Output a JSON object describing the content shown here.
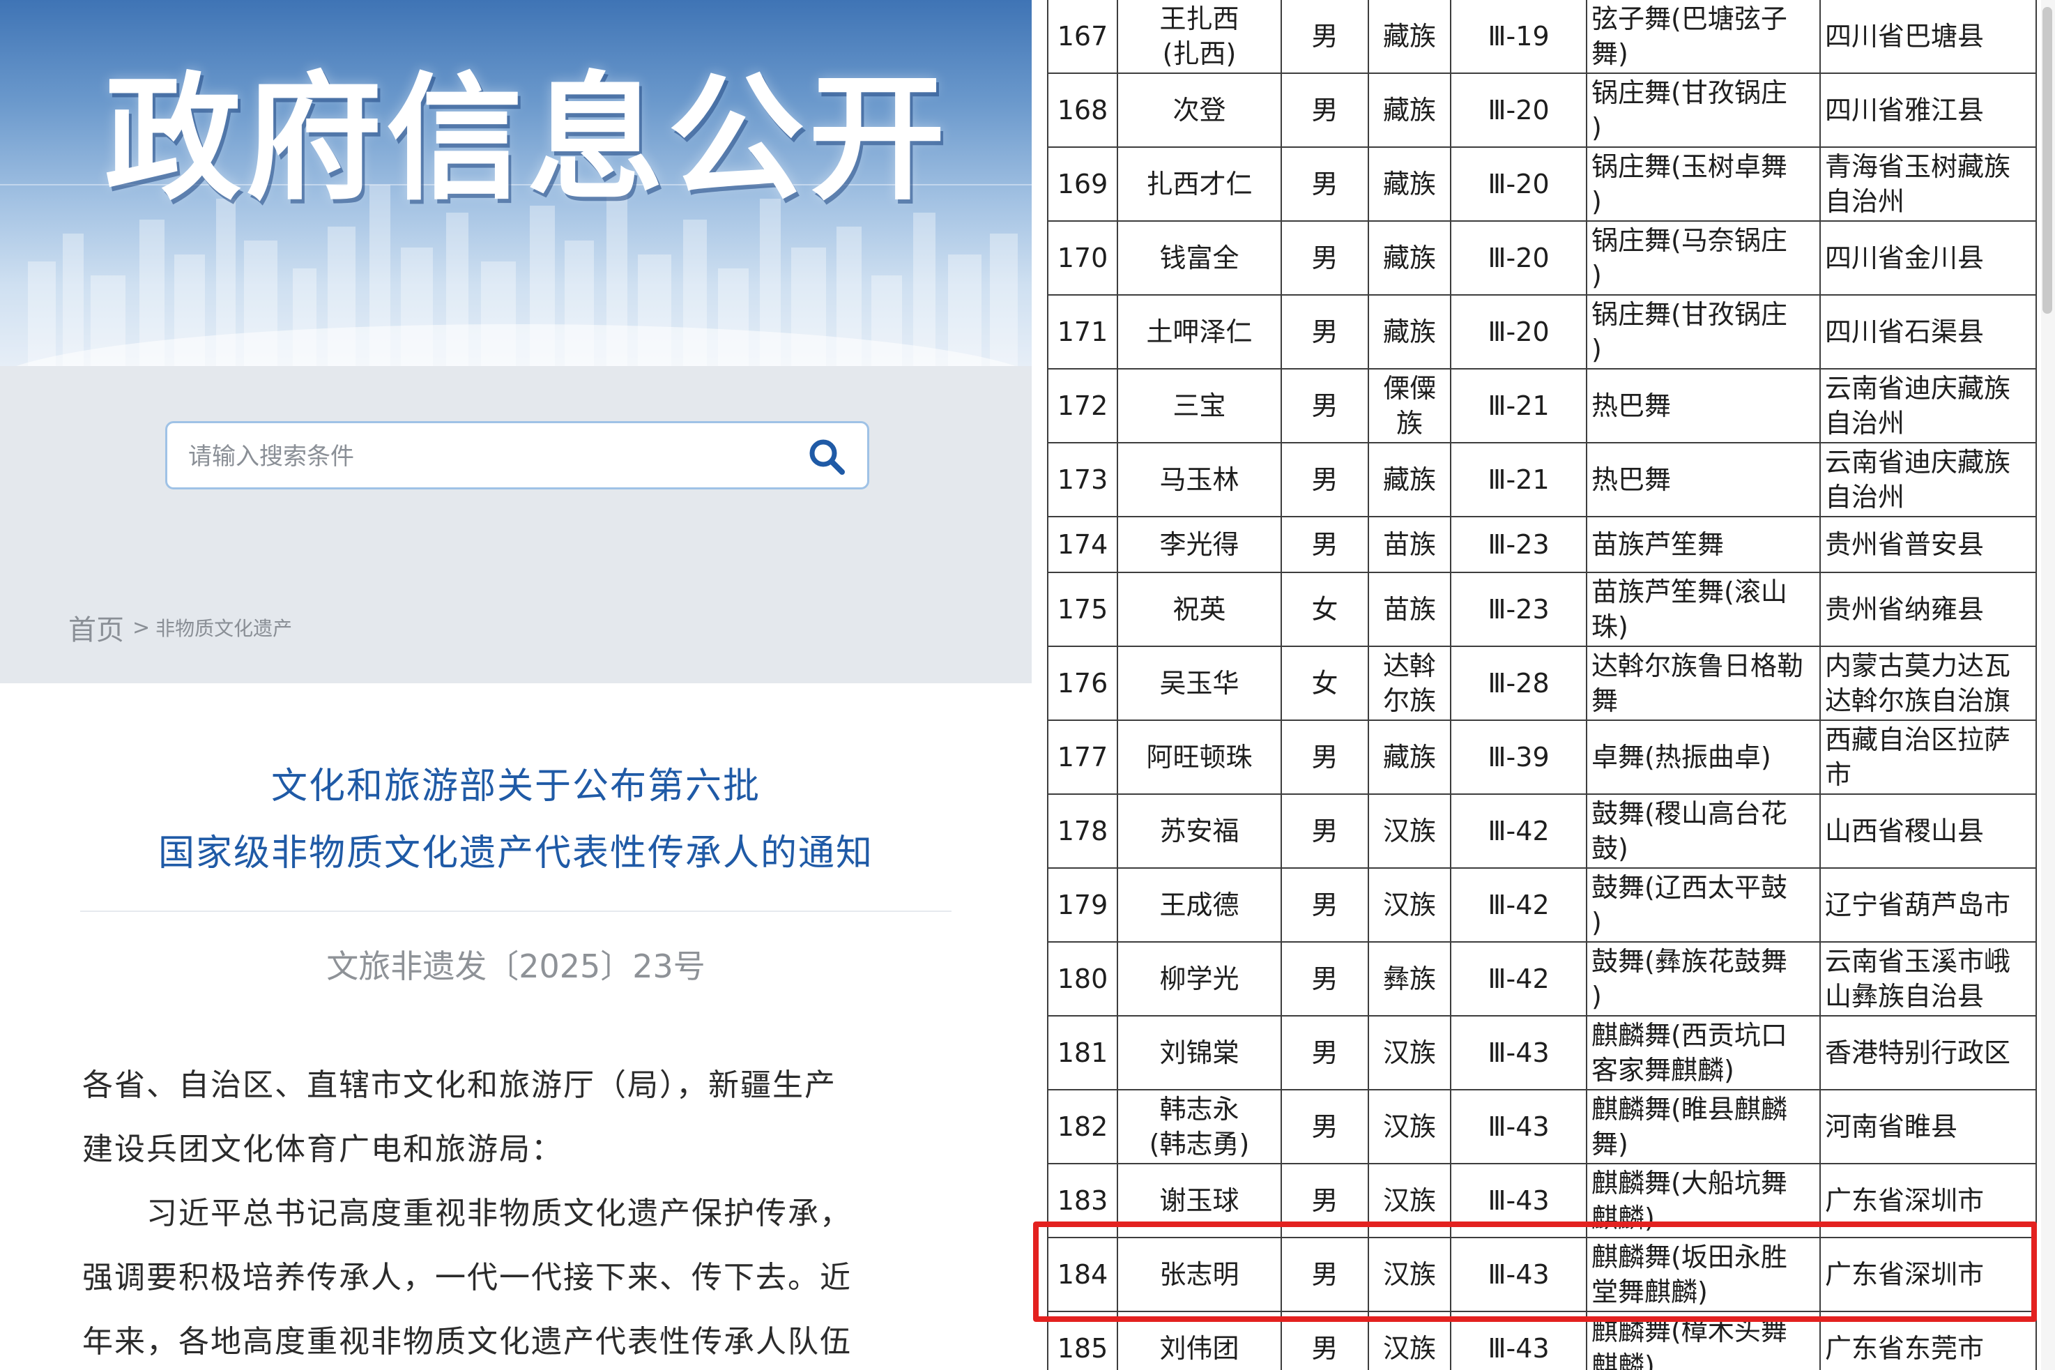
{
  "banner": {
    "title": "政府信息公开"
  },
  "search": {
    "placeholder": "请输入搜索条件"
  },
  "breadcrumb": {
    "home": "首页",
    "separator": ">",
    "current": "非物质文化遗产"
  },
  "notice": {
    "title_line1": "文化和旅游部关于公布第六批",
    "title_line2": "国家级非物质文化遗产代表性传承人的通知",
    "doc_number": "文旅非遗发〔2025〕23号",
    "body_lines": [
      "各省、自治区、直辖市文化和旅游厅（局），新疆生产",
      "建设兵团文化体育广电和旅游局：",
      "　　习近平总书记高度重视非物质文化遗产保护传承，",
      "强调要积极培养传承人，一代一代接下来、传下去。近",
      "年来，各地高度重视非物质文化遗产代表性传承人队伍"
    ]
  },
  "table": {
    "rows": [
      {
        "no": "167",
        "name": [
          "王扎西",
          "(扎西)"
        ],
        "gender": "男",
        "ethnicity": [
          "藏族"
        ],
        "code": "Ⅲ-19",
        "item": [
          "弦子舞(巴塘弦子",
          "舞)"
        ],
        "region": [
          "四川省巴塘县"
        ]
      },
      {
        "no": "168",
        "name": [
          "次登"
        ],
        "gender": "男",
        "ethnicity": [
          "藏族"
        ],
        "code": "Ⅲ-20",
        "item": [
          "锅庄舞(甘孜锅庄",
          ")"
        ],
        "region": [
          "四川省雅江县"
        ]
      },
      {
        "no": "169",
        "name": [
          "扎西才仁"
        ],
        "gender": "男",
        "ethnicity": [
          "藏族"
        ],
        "code": "Ⅲ-20",
        "item": [
          "锅庄舞(玉树卓舞",
          ")"
        ],
        "region": [
          "青海省玉树藏族",
          "自治州"
        ]
      },
      {
        "no": "170",
        "name": [
          "钱富全"
        ],
        "gender": "男",
        "ethnicity": [
          "藏族"
        ],
        "code": "Ⅲ-20",
        "item": [
          "锅庄舞(马奈锅庄",
          ")"
        ],
        "region": [
          "四川省金川县"
        ]
      },
      {
        "no": "171",
        "name": [
          "土呷泽仁"
        ],
        "gender": "男",
        "ethnicity": [
          "藏族"
        ],
        "code": "Ⅲ-20",
        "item": [
          "锅庄舞(甘孜锅庄",
          ")"
        ],
        "region": [
          "四川省石渠县"
        ]
      },
      {
        "no": "172",
        "name": [
          "三宝"
        ],
        "gender": "男",
        "ethnicity": [
          "傈僳",
          "族"
        ],
        "code": "Ⅲ-21",
        "item": [
          "热巴舞"
        ],
        "region": [
          "云南省迪庆藏族",
          "自治州"
        ]
      },
      {
        "no": "173",
        "name": [
          "马玉林"
        ],
        "gender": "男",
        "ethnicity": [
          "藏族"
        ],
        "code": "Ⅲ-21",
        "item": [
          "热巴舞"
        ],
        "region": [
          "云南省迪庆藏族",
          "自治州"
        ]
      },
      {
        "no": "174",
        "name": [
          "李光得"
        ],
        "gender": "男",
        "ethnicity": [
          "苗族"
        ],
        "code": "Ⅲ-23",
        "item": [
          "苗族芦笙舞"
        ],
        "region": [
          "贵州省普安县"
        ]
      },
      {
        "no": "175",
        "name": [
          "祝英"
        ],
        "gender": "女",
        "ethnicity": [
          "苗族"
        ],
        "code": "Ⅲ-23",
        "item": [
          "苗族芦笙舞(滚山",
          "珠)"
        ],
        "region": [
          "贵州省纳雍县"
        ]
      },
      {
        "no": "176",
        "name": [
          "吴玉华"
        ],
        "gender": "女",
        "ethnicity": [
          "达斡",
          "尔族"
        ],
        "code": "Ⅲ-28",
        "item": [
          "达斡尔族鲁日格勒",
          "舞"
        ],
        "region": [
          "内蒙古莫力达瓦",
          "达斡尔族自治旗"
        ]
      },
      {
        "no": "177",
        "name": [
          "阿旺顿珠"
        ],
        "gender": "男",
        "ethnicity": [
          "藏族"
        ],
        "code": "Ⅲ-39",
        "item": [
          "卓舞(热振曲卓)"
        ],
        "region": [
          "西藏自治区拉萨",
          "市"
        ]
      },
      {
        "no": "178",
        "name": [
          "苏安福"
        ],
        "gender": "男",
        "ethnicity": [
          "汉族"
        ],
        "code": "Ⅲ-42",
        "item": [
          "鼓舞(稷山高台花",
          "鼓)"
        ],
        "region": [
          "山西省稷山县"
        ]
      },
      {
        "no": "179",
        "name": [
          "王成德"
        ],
        "gender": "男",
        "ethnicity": [
          "汉族"
        ],
        "code": "Ⅲ-42",
        "item": [
          "鼓舞(辽西太平鼓",
          ")"
        ],
        "region": [
          "辽宁省葫芦岛市"
        ]
      },
      {
        "no": "180",
        "name": [
          "柳学光"
        ],
        "gender": "男",
        "ethnicity": [
          "彝族"
        ],
        "code": "Ⅲ-42",
        "item": [
          "鼓舞(彝族花鼓舞",
          ")"
        ],
        "region": [
          "云南省玉溪市峨",
          "山彝族自治县"
        ]
      },
      {
        "no": "181",
        "name": [
          "刘锦棠"
        ],
        "gender": "男",
        "ethnicity": [
          "汉族"
        ],
        "code": "Ⅲ-43",
        "item": [
          "麒麟舞(西贡坑口",
          "客家舞麒麟)"
        ],
        "region": [
          "香港特别行政区"
        ]
      },
      {
        "no": "182",
        "name": [
          "韩志永",
          "(韩志勇)"
        ],
        "gender": "男",
        "ethnicity": [
          "汉族"
        ],
        "code": "Ⅲ-43",
        "item": [
          "麒麟舞(睢县麒麟",
          "舞)"
        ],
        "region": [
          "河南省睢县"
        ]
      },
      {
        "no": "183",
        "name": [
          "谢玉球"
        ],
        "gender": "男",
        "ethnicity": [
          "汉族"
        ],
        "code": "Ⅲ-43",
        "item": [
          "麒麟舞(大船坑舞",
          "麒麟)"
        ],
        "region": [
          "广东省深圳市"
        ]
      },
      {
        "no": "184",
        "name": [
          "张志明"
        ],
        "gender": "男",
        "ethnicity": [
          "汉族"
        ],
        "code": "Ⅲ-43",
        "item": [
          "麒麟舞(坂田永胜",
          "堂舞麒麟)"
        ],
        "region": [
          "广东省深圳市"
        ]
      },
      {
        "no": "185",
        "name": [
          "刘伟团"
        ],
        "gender": "男",
        "ethnicity": [
          "汉族"
        ],
        "code": "Ⅲ-43",
        "item": [
          "麒麟舞(樟木头舞",
          "麒麟)"
        ],
        "region": [
          "广东省东莞市"
        ]
      }
    ]
  },
  "colors": {
    "highlight": "#e3211f",
    "title_blue": "#1f5aa6",
    "banner_blue": "#3f74b5"
  }
}
